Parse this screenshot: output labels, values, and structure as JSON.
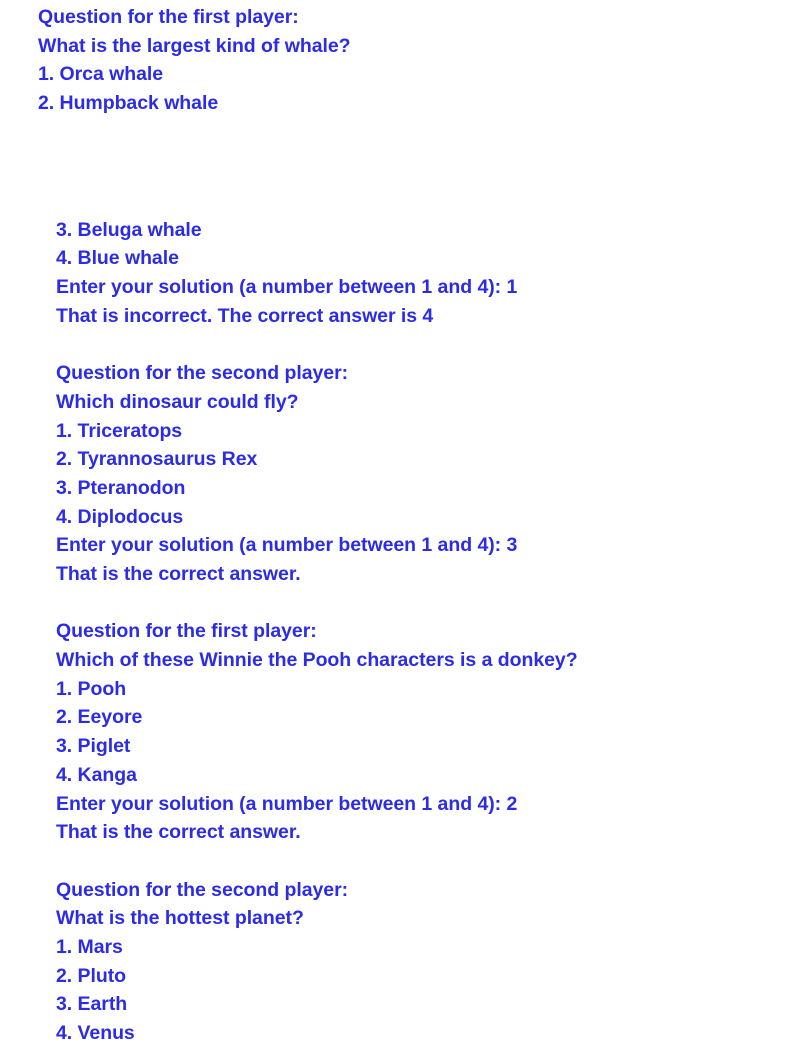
{
  "theme": {
    "background": "#ffffff",
    "text_color": "#2c2ce8"
  },
  "transcript": {
    "block1": {
      "prompt": "Question for the first player:",
      "question": "What is the largest kind of whale?",
      "option1": "1. Orca whale",
      "option2": "2. Humpback whale"
    },
    "block1_cont": {
      "option3": "3. Beluga whale",
      "option4": "4. Blue whale",
      "input_line": "Enter your solution (a number between 1 and 4): 1",
      "result": "That is incorrect. The correct answer is 4"
    },
    "block2": {
      "prompt": "Question for the second player:",
      "question": "Which dinosaur could fly?",
      "option1": "1. Triceratops",
      "option2": "2. Tyrannosaurus Rex",
      "option3": "3. Pteranodon",
      "option4": "4. Diplodocus",
      "input_line": "Enter your solution (a number between 1 and 4): 3",
      "result": "That is the correct answer."
    },
    "block3": {
      "prompt": "Question for the first player:",
      "question": "Which of these Winnie the Pooh characters is a donkey?",
      "option1": "1. Pooh",
      "option2": "2. Eeyore",
      "option3": "3. Piglet",
      "option4": "4. Kanga",
      "input_line": "Enter your solution (a number between 1 and 4): 2",
      "result": "That is the correct answer."
    },
    "block4": {
      "prompt": "Question for the second player:",
      "question": "What is the hottest planet?",
      "option1": "1. Mars",
      "option2": "2. Pluto",
      "option3": "3. Earth",
      "option4": "4. Venus"
    }
  }
}
